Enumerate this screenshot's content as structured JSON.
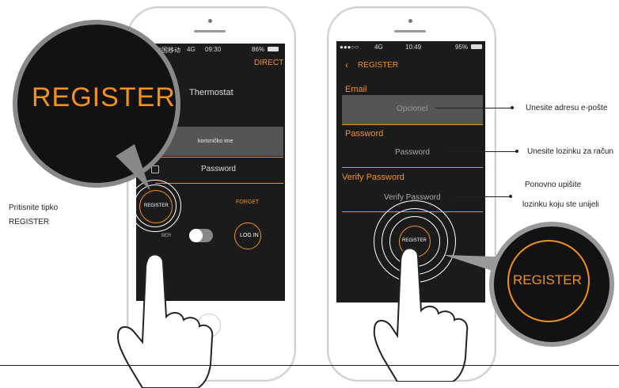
{
  "left_phone": {
    "status": {
      "carrier": "中国移动",
      "network": "4G",
      "time": "09:30",
      "battery": "86%"
    },
    "direct_label": "DIRECT",
    "app_title": "Thermostat",
    "username_placeholder": "korisničko ime",
    "password_placeholder": "Password",
    "register_button": "REGISTER",
    "forget_link": "FORGET",
    "remember_label": "BER",
    "login_button": "LOG IN"
  },
  "right_phone": {
    "status": {
      "network": "4G",
      "time": "10:49",
      "battery": "95%"
    },
    "header_title": "REGISTER",
    "email_label": "Email",
    "email_placeholder": "Opcionel",
    "password_label": "Password",
    "password_placeholder": "Password",
    "verify_label": "Verify Password",
    "verify_placeholder": "Verify Password",
    "register_button": "REGISTER"
  },
  "magnifier_left_text": "REGISTER",
  "magnifier_right_text": "REGISTER",
  "annotations": {
    "press_register_1": "Pritisnite tipko",
    "press_register_2": "REGISTER",
    "email_note": "Unesite adresu e-pošte",
    "password_note": "Unesite lozinku za račun",
    "verify_note_1": "Ponovno upišite",
    "verify_note_2": "lozinku koju ste unijeli"
  },
  "colors": {
    "accent": "#f2911b",
    "screen": "#1b1b1b"
  }
}
